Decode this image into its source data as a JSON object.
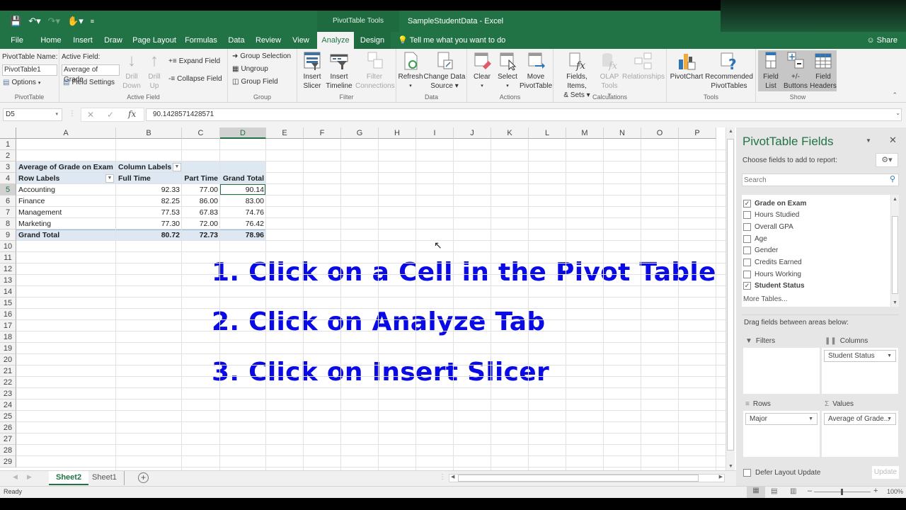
{
  "titlebar": {
    "contextual_group": "PivotTable Tools",
    "document_title": "SampleStudentData  -  Excel"
  },
  "ribbon_tabs": [
    "File",
    "Home",
    "Insert",
    "Draw",
    "Page Layout",
    "Formulas",
    "Data",
    "Review",
    "View",
    "Analyze",
    "Design"
  ],
  "active_tab": "Analyze",
  "tell_me": "Tell me what you want to do",
  "share": "Share",
  "ribbon": {
    "pivottable": {
      "name_label": "PivotTable Name:",
      "name_value": "PivotTable1",
      "options": "Options",
      "group": "PivotTable"
    },
    "active_field": {
      "label": "Active Field:",
      "value": "Average of Grade",
      "field_settings": "Field Settings",
      "drill_down": [
        "Drill",
        "Down"
      ],
      "drill_up": [
        "Drill",
        "Up"
      ],
      "expand": "Expand Field",
      "collapse": "Collapse Field",
      "group": "Active Field"
    },
    "group": {
      "group_selection": "Group Selection",
      "ungroup": "Ungroup",
      "group_field": "Group Field",
      "group": "Group"
    },
    "filter": {
      "insert_slicer": [
        "Insert",
        "Slicer"
      ],
      "insert_timeline": [
        "Insert",
        "Timeline"
      ],
      "filter_connections": [
        "Filter",
        "Connections"
      ],
      "group": "Filter"
    },
    "data": {
      "refresh": [
        "Refresh",
        "▾"
      ],
      "change_source": [
        "Change Data",
        "Source ▾"
      ],
      "group": "Data"
    },
    "actions": {
      "clear": [
        "Clear",
        "▾"
      ],
      "select": [
        "Select",
        "▾"
      ],
      "move": [
        "Move",
        "PivotTable"
      ],
      "group": "Actions"
    },
    "calculations": {
      "fields_items": [
        "Fields, Items,",
        "& Sets ▾"
      ],
      "olap": [
        "OLAP",
        "Tools ▾"
      ],
      "relationships": "Relationships",
      "group": "Calculations"
    },
    "tools": {
      "pivotchart": "PivotChart",
      "recommended": [
        "Recommended",
        "PivotTables"
      ],
      "group": "Tools"
    },
    "show": {
      "field_list": [
        "Field",
        "List"
      ],
      "buttons": [
        "+/-",
        "Buttons"
      ],
      "headers": [
        "Field",
        "Headers"
      ],
      "group": "Show"
    }
  },
  "formula_bar": {
    "name_box": "D5",
    "formula": "90.1428571428571"
  },
  "columns": [
    "A",
    "B",
    "C",
    "D",
    "E",
    "F",
    "G",
    "H",
    "I",
    "J",
    "K",
    "L",
    "M",
    "N",
    "O",
    "P"
  ],
  "rows": [
    "1",
    "2",
    "3",
    "4",
    "5",
    "6",
    "7",
    "8",
    "9",
    "10",
    "11",
    "12",
    "13",
    "14",
    "15",
    "16",
    "17",
    "18",
    "19",
    "20",
    "21",
    "22",
    "23",
    "24",
    "25",
    "26",
    "27",
    "28",
    "29"
  ],
  "pivot": {
    "corner": "Average of Grade on Exam",
    "column_labels": "Column Labels",
    "row_labels": "Row Labels",
    "headers": [
      "Full Time",
      "Part Time",
      "Grand Total"
    ],
    "rows": [
      {
        "label": "Accounting",
        "values": [
          "92.33",
          "77.00",
          "90.14"
        ]
      },
      {
        "label": "Finance",
        "values": [
          "82.25",
          "86.00",
          "83.00"
        ]
      },
      {
        "label": "Management",
        "values": [
          "77.53",
          "67.83",
          "74.76"
        ]
      },
      {
        "label": "Marketing",
        "values": [
          "77.30",
          "72.00",
          "76.42"
        ]
      }
    ],
    "grand_total": {
      "label": "Grand Total",
      "values": [
        "80.72",
        "72.73",
        "78.96"
      ]
    }
  },
  "instructions": [
    "1.  Click on a Cell in the Pivot Table",
    "2.  Click on Analyze Tab",
    "3.  Click on Insert Slicer"
  ],
  "sheet_tabs": [
    "Sheet2",
    "Sheet1"
  ],
  "active_sheet": "Sheet2",
  "status": "Ready",
  "zoom": "100%",
  "pane": {
    "title": "PivotTable Fields",
    "choose": "Choose fields to add to report:",
    "search_placeholder": "Search",
    "fields": [
      {
        "name": "Grade on Exam",
        "checked": true
      },
      {
        "name": "Hours Studied",
        "checked": false
      },
      {
        "name": "Overall GPA",
        "checked": false
      },
      {
        "name": "Age",
        "checked": false
      },
      {
        "name": "Gender",
        "checked": false
      },
      {
        "name": "Credits Earned",
        "checked": false
      },
      {
        "name": "Hours Working",
        "checked": false
      },
      {
        "name": "Student Status",
        "checked": true
      }
    ],
    "more_tables": "More Tables...",
    "drag_label": "Drag fields between areas below:",
    "areas": {
      "filters": {
        "label": "Filters",
        "items": []
      },
      "columns": {
        "label": "Columns",
        "items": [
          "Student Status"
        ]
      },
      "rows": {
        "label": "Rows",
        "items": [
          "Major"
        ]
      },
      "values": {
        "label": "Values",
        "items": [
          "Average of Grade..."
        ]
      }
    },
    "defer": "Defer Layout Update",
    "update": "Update"
  },
  "colors": {
    "excel_green": "#217346",
    "instruction_blue": "#0a0ae6",
    "pivot_band": "#dde8f3"
  }
}
